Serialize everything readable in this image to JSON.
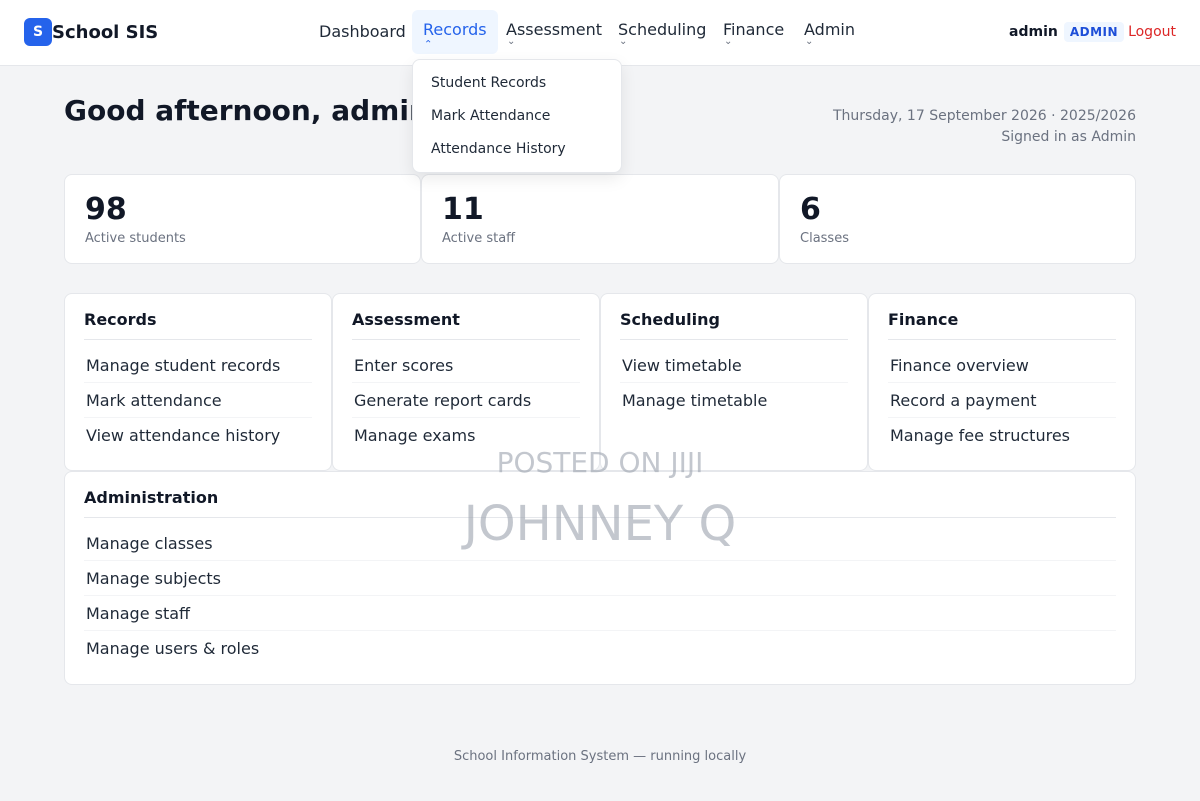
{
  "brand": {
    "logo_letter": "S",
    "name": "School SIS"
  },
  "nav": {
    "dashboard": "Dashboard",
    "records": "Records",
    "assessment": "Assessment",
    "scheduling": "Scheduling",
    "finance": "Finance",
    "admin": "Admin",
    "caret": "⌄"
  },
  "user": {
    "name": "admin",
    "role": "ADMIN",
    "logout": "Logout"
  },
  "dropdown": {
    "items": [
      "Student Records",
      "Mark Attendance",
      "Attendance History"
    ]
  },
  "greeting": "Good afternoon, admin",
  "date_info": {
    "line1": "Thursday, 17 September 2026 · 2025/2026",
    "line2": "Signed in as Admin"
  },
  "stats": [
    {
      "value": "98",
      "label": "Active students"
    },
    {
      "value": "11",
      "label": "Active staff"
    },
    {
      "value": "6",
      "label": "Classes"
    }
  ],
  "modules": {
    "records": {
      "title": "Records",
      "links": [
        "Manage student records",
        "Mark attendance",
        "View attendance history"
      ]
    },
    "assessment": {
      "title": "Assessment",
      "links": [
        "Enter scores",
        "Generate report cards",
        "Manage exams"
      ]
    },
    "scheduling": {
      "title": "Scheduling",
      "links": [
        "View timetable",
        "Manage timetable"
      ]
    },
    "finance": {
      "title": "Finance",
      "links": [
        "Finance overview",
        "Record a payment",
        "Manage fee structures"
      ]
    },
    "administration": {
      "title": "Administration",
      "links": [
        "Manage classes",
        "Manage subjects",
        "Manage staff",
        "Manage users & roles"
      ]
    }
  },
  "watermark": {
    "line1": "POSTED ON JIJI",
    "line2": "JOHNNEY Q"
  },
  "footer": "School Information System — running locally",
  "colors": {
    "accent": "#2563eb",
    "logout": "#dc2626",
    "background": "#f3f4f6"
  }
}
